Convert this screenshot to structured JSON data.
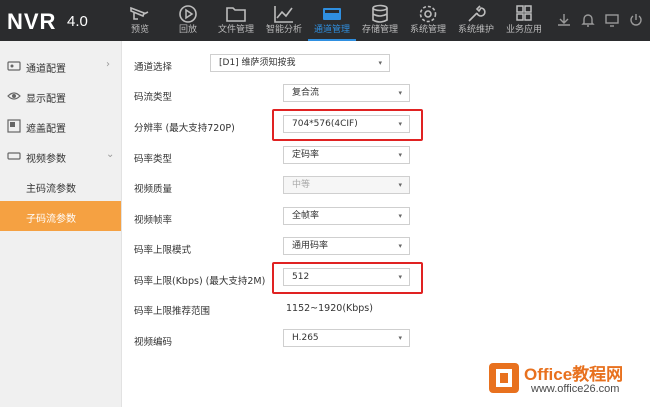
{
  "app": {
    "logo": "NVR",
    "version": "4.0"
  },
  "nav": [
    {
      "label": "预览",
      "icon": "camera-icon"
    },
    {
      "label": "回放",
      "icon": "playback-icon"
    },
    {
      "label": "文件管理",
      "icon": "folder-icon"
    },
    {
      "label": "智能分析",
      "icon": "analysis-icon"
    },
    {
      "label": "通道管理",
      "icon": "channel-icon",
      "active": true
    },
    {
      "label": "存储管理",
      "icon": "database-icon"
    },
    {
      "label": "系统管理",
      "icon": "gear-icon"
    },
    {
      "label": "系统维护",
      "icon": "wrench-icon"
    },
    {
      "label": "业务应用",
      "icon": "apps-icon"
    }
  ],
  "toolbar": [
    "download-icon",
    "bell-icon",
    "monitor-icon",
    "power-icon"
  ],
  "sidebar": {
    "items": [
      {
        "label": "通道配置",
        "icon": "channel-config-icon",
        "arrow": "›"
      },
      {
        "label": "显示配置",
        "icon": "eye-icon"
      },
      {
        "label": "遮盖配置",
        "icon": "mask-icon"
      },
      {
        "label": "视频参数",
        "icon": "video-icon",
        "arrow": "⌄"
      }
    ],
    "subitems": [
      {
        "label": "主码流参数",
        "active": false
      },
      {
        "label": "子码流参数",
        "active": true
      }
    ]
  },
  "form": {
    "channel": {
      "label": "通道选择",
      "value": "[D1] 维萨须知按我"
    },
    "stream_type": {
      "label": "码流类型",
      "value": "复合流"
    },
    "resolution": {
      "label": "分辨率 (最大支持720P)",
      "value": "704*576(4CIF)"
    },
    "bitrate_type": {
      "label": "码率类型",
      "value": "定码率"
    },
    "quality": {
      "label": "视频质量",
      "value": "中等"
    },
    "framerate": {
      "label": "视频帧率",
      "value": "全帧率"
    },
    "bitrate_mode": {
      "label": "码率上限模式",
      "value": "通用码率"
    },
    "bitrate_cap": {
      "label": "码率上限(Kbps) (最大支持2M)",
      "value": "512"
    },
    "bitrate_range": {
      "label": "码率上限推荐范围",
      "value": "1152~1920(Kbps)"
    },
    "encoding": {
      "label": "视频编码",
      "value": "H.265"
    },
    "caret": "▾"
  },
  "watermark": {
    "title": "Office教程网",
    "url": "www.office26.com"
  },
  "colors": {
    "accent": "#2f8fe0",
    "active_sub": "#f5a142",
    "highlight": "#e02222",
    "topbar": "#2b2c2e"
  }
}
